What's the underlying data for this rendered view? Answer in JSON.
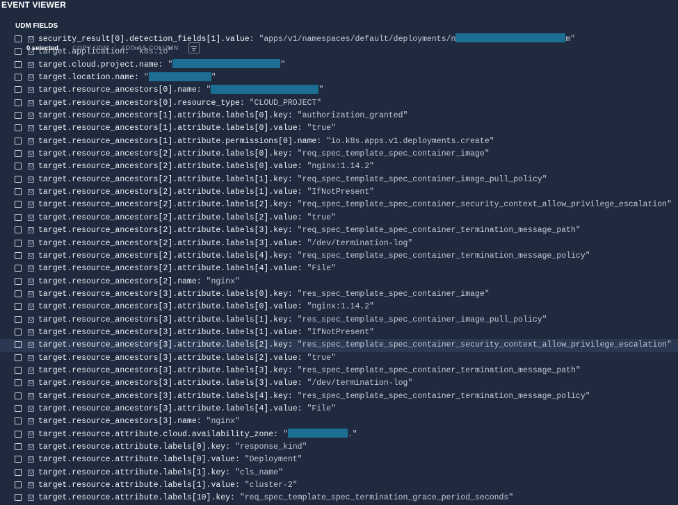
{
  "header": {
    "title": "EVENT VIEWER",
    "section": "UDM FIELDS"
  },
  "toolbar": {
    "selected_label": "0 selected",
    "copy_label": "COPY UDM",
    "add_column_label": "ADD AS COLUMN",
    "filter_icon": "filter-icon"
  },
  "badge_letter": "U",
  "redaction_color": "#1d6e93",
  "rows": [
    {
      "key": "security_result[0].detection_fields[1].value: ",
      "val": "\"apps/v1/namespaces/default/deployments/n",
      "redact": 158,
      "tail": "m\""
    },
    {
      "key": "target.application: ",
      "val": "\"k8s.io\""
    },
    {
      "key": "target.cloud.project.name: ",
      "val": "\"",
      "redact": 155,
      "tail": "\""
    },
    {
      "key": "target.location.name: ",
      "val": "\"",
      "redact": 90,
      "tail": "\""
    },
    {
      "key": "target.resource_ancestors[0].name: ",
      "val": "\"",
      "redact": 155,
      "tail": "\""
    },
    {
      "key": "target.resource_ancestors[0].resource_type: ",
      "val": "\"CLOUD_PROJECT\""
    },
    {
      "key": "target.resource_ancestors[1].attribute.labels[0].key: ",
      "val": "\"authorization_granted\""
    },
    {
      "key": "target.resource_ancestors[1].attribute.labels[0].value: ",
      "val": "\"true\""
    },
    {
      "key": "target.resource_ancestors[1].attribute.permissions[0].name: ",
      "val": "\"io.k8s.apps.v1.deployments.create\""
    },
    {
      "key": "target.resource_ancestors[2].attribute.labels[0].key: ",
      "val": "\"req_spec_template_spec_container_image\""
    },
    {
      "key": "target.resource_ancestors[2].attribute.labels[0].value: ",
      "val": "\"nginx:1.14.2\""
    },
    {
      "key": "target.resource_ancestors[2].attribute.labels[1].key: ",
      "val": "\"req_spec_template_spec_container_image_pull_policy\""
    },
    {
      "key": "target.resource_ancestors[2].attribute.labels[1].value: ",
      "val": "\"IfNotPresent\""
    },
    {
      "key": "target.resource_ancestors[2].attribute.labels[2].key: ",
      "val": "\"req_spec_template_spec_container_security_context_allow_privilege_escalation\""
    },
    {
      "key": "target.resource_ancestors[2].attribute.labels[2].value: ",
      "val": "\"true\""
    },
    {
      "key": "target.resource_ancestors[2].attribute.labels[3].key: ",
      "val": "\"req_spec_template_spec_container_termination_message_path\""
    },
    {
      "key": "target.resource_ancestors[2].attribute.labels[3].value: ",
      "val": "\"/dev/termination-log\""
    },
    {
      "key": "target.resource_ancestors[2].attribute.labels[4].key: ",
      "val": "\"req_spec_template_spec_container_termination_message_policy\""
    },
    {
      "key": "target.resource_ancestors[2].attribute.labels[4].value: ",
      "val": "\"File\""
    },
    {
      "key": "target.resource_ancestors[2].name: ",
      "val": "\"nginx\""
    },
    {
      "key": "target.resource_ancestors[3].attribute.labels[0].key: ",
      "val": "\"res_spec_template_spec_container_image\""
    },
    {
      "key": "target.resource_ancestors[3].attribute.labels[0].value: ",
      "val": "\"nginx:1.14.2\""
    },
    {
      "key": "target.resource_ancestors[3].attribute.labels[1].key: ",
      "val": "\"res_spec_template_spec_container_image_pull_policy\""
    },
    {
      "key": "target.resource_ancestors[3].attribute.labels[1].value: ",
      "val": "\"IfNotPresent\""
    },
    {
      "key": "target.resource_ancestors[3].attribute.labels[2].key: ",
      "val": "\"res_spec_template_spec_container_security_context_allow_privilege_escalation\"",
      "highlight": true
    },
    {
      "key": "target.resource_ancestors[3].attribute.labels[2].value: ",
      "val": "\"true\""
    },
    {
      "key": "target.resource_ancestors[3].attribute.labels[3].key: ",
      "val": "\"res_spec_template_spec_container_termination_message_path\""
    },
    {
      "key": "target.resource_ancestors[3].attribute.labels[3].value: ",
      "val": "\"/dev/termination-log\""
    },
    {
      "key": "target.resource_ancestors[3].attribute.labels[4].key: ",
      "val": "\"res_spec_template_spec_container_termination_message_policy\""
    },
    {
      "key": "target.resource_ancestors[3].attribute.labels[4].value: ",
      "val": "\"File\""
    },
    {
      "key": "target.resource_ancestors[3].name: ",
      "val": "\"nginx\""
    },
    {
      "key": "target.resource.attribute.cloud.availability_zone: ",
      "val": "\"",
      "redact": 86,
      "tail": ".\""
    },
    {
      "key": "target.resource.attribute.labels[0].key: ",
      "val": "\"response_kind\""
    },
    {
      "key": "target.resource.attribute.labels[0].value: ",
      "val": "\"Deployment\""
    },
    {
      "key": "target.resource.attribute.labels[1].key: ",
      "val": "\"cls_name\""
    },
    {
      "key": "target.resource.attribute.labels[1].value: ",
      "val": "\"cluster-2\""
    },
    {
      "key": "target.resource.attribute.labels[10].key: ",
      "val": "\"req_spec_template_spec_termination_grace_period_seconds\""
    }
  ]
}
